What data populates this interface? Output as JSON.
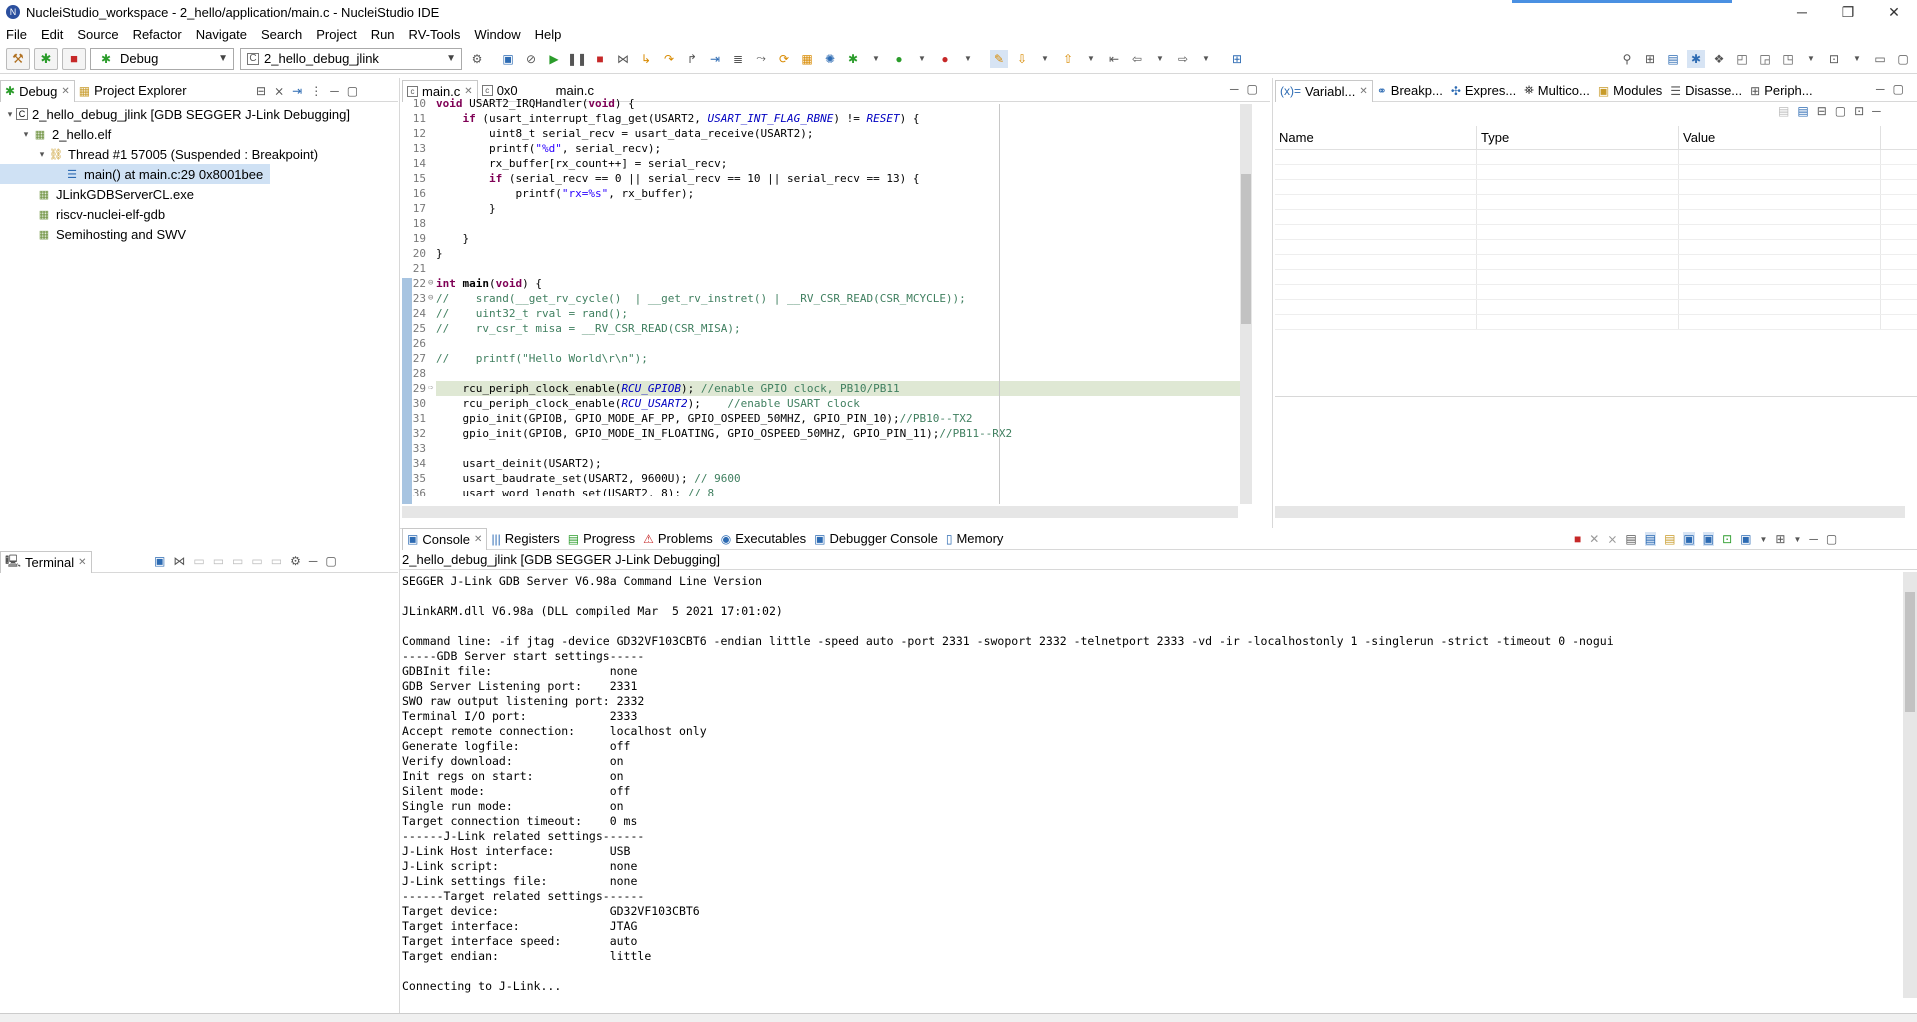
{
  "window": {
    "title": "NucleiStudio_workspace - 2_hello/application/main.c - NucleiStudio IDE"
  },
  "menu": [
    "File",
    "Edit",
    "Source",
    "Refactor",
    "Navigate",
    "Search",
    "Project",
    "Run",
    "RV-Tools",
    "Window",
    "Help"
  ],
  "toolbar": {
    "launch_mode": "Debug",
    "launch_config": "2_hello_debug_jlink"
  },
  "debug_view": {
    "tabs": [
      {
        "label": "Debug",
        "icon": "debug-bug-icon",
        "active": true
      },
      {
        "label": "Project Explorer",
        "icon": "folder-icon",
        "active": false
      }
    ],
    "tree": [
      {
        "label": "2_hello_debug_jlink [GDB SEGGER J-Link Debugging]",
        "level": 0,
        "icon": "c-launch-icon",
        "expanded": true
      },
      {
        "label": "2_hello.elf",
        "level": 1,
        "icon": "elf-icon",
        "expanded": true
      },
      {
        "label": "Thread #1 57005 (Suspended : Breakpoint)",
        "level": 2,
        "icon": "thread-icon",
        "expanded": true
      },
      {
        "label": "main() at main.c:29 0x8001bee",
        "level": 3,
        "icon": "stack-frame-icon",
        "selected": true
      },
      {
        "label": "JLinkGDBServerCL.exe",
        "level": 1,
        "icon": "process-icon"
      },
      {
        "label": "riscv-nuclei-elf-gdb",
        "level": 1,
        "icon": "process-icon"
      },
      {
        "label": "Semihosting and SWV",
        "level": 1,
        "icon": "process-icon"
      }
    ]
  },
  "terminal_view": {
    "tab": "Terminal"
  },
  "editor": {
    "tabs": [
      {
        "label": "main.c",
        "active": true
      },
      {
        "label": "0x0",
        "active": false
      },
      {
        "label": "main.c",
        "active": false
      }
    ],
    "first_line_partial": "void USART2_IRQHandler(void) {",
    "lines": [
      {
        "n": "10",
        "html": "<span class=\"kw\">void</span> USART2_IRQHandler(<span class=\"kw\">void</span>) {"
      },
      {
        "n": "11",
        "html": "    <span class=\"kw\">if</span> (usart_interrupt_flag_get(USART2, <span class=\"mac\">USART_INT_FLAG_RBNE</span>) != <span class=\"mac\">RESET</span>) {"
      },
      {
        "n": "12",
        "html": "        uint8_t serial_recv = usart_data_receive(USART2);"
      },
      {
        "n": "13",
        "html": "        printf(<span class=\"str\">\"%d\"</span>, serial_recv);"
      },
      {
        "n": "14",
        "html": "        rx_buffer[rx_count++] = serial_recv;"
      },
      {
        "n": "15",
        "html": "        <span class=\"kw\">if</span> (serial_recv == 0 || serial_recv == 10 || serial_recv == 13) {"
      },
      {
        "n": "16",
        "html": "            printf(<span class=\"str\">\"rx=%s\"</span>, rx_buffer);"
      },
      {
        "n": "17",
        "html": "        }"
      },
      {
        "n": "18",
        "html": ""
      },
      {
        "n": "19",
        "html": "    }"
      },
      {
        "n": "20",
        "html": "}"
      },
      {
        "n": "21",
        "html": ""
      },
      {
        "n": "22",
        "html": "<span class=\"kw\">int</span> <b>main</b>(<span class=\"kw\">void</span>) {",
        "fold": "⊖"
      },
      {
        "n": "23",
        "html": "<span class=\"cm\">//    srand(__get_rv_cycle()  | __get_rv_instret() | __RV_CSR_READ(CSR_MCYCLE));</span>",
        "fold": "⊖"
      },
      {
        "n": "24",
        "html": "<span class=\"cm\">//    uint32_t rval = rand();</span>"
      },
      {
        "n": "25",
        "html": "<span class=\"cm\">//    rv_csr_t misa = __RV_CSR_READ(CSR_MISA);</span>"
      },
      {
        "n": "26",
        "html": ""
      },
      {
        "n": "27",
        "html": "<span class=\"cm\">//    printf(\"Hello World\\r\\n\");</span>"
      },
      {
        "n": "28",
        "html": ""
      },
      {
        "n": "29",
        "html": "    rcu_periph_clock_enable(<span class=\"mac\">RCU_GPIOB</span>); <span class=\"cm\">//enable GPIO clock, PB10/PB11</span>",
        "hl": true,
        "fold": "⇨"
      },
      {
        "n": "30",
        "html": "    rcu_periph_clock_enable(<span class=\"mac\">RCU_USART2</span>);    <span class=\"cm\">//enable USART clock</span>"
      },
      {
        "n": "31",
        "html": "    gpio_init(GPIOB, GPIO_MODE_AF_PP, GPIO_OSPEED_50MHZ, GPIO_PIN_10);<span class=\"cm\">//PB10--TX2</span>"
      },
      {
        "n": "32",
        "html": "    gpio_init(GPIOB, GPIO_MODE_IN_FLOATING, GPIO_OSPEED_50MHZ, GPIO_PIN_11);<span class=\"cm\">//PB11--RX2</span>"
      },
      {
        "n": "33",
        "html": ""
      },
      {
        "n": "34",
        "html": "    usart_deinit(USART2);"
      },
      {
        "n": "35",
        "html": "    usart_baudrate_set(USART2, 9600U); <span class=\"cm\">// 9600</span>"
      },
      {
        "n": "36",
        "html": "    usart_word_length_set(USART2, 8); <span class=\"cm\">// 8</span>"
      }
    ]
  },
  "right_view": {
    "tabs": [
      {
        "label": "Variabl...",
        "icon": "variables-icon",
        "active": true
      },
      {
        "label": "Breakp...",
        "icon": "breakpoints-icon"
      },
      {
        "label": "Expres...",
        "icon": "expressions-icon"
      },
      {
        "label": "Multico...",
        "icon": "multicore-icon"
      },
      {
        "label": "Modules",
        "icon": "modules-icon"
      },
      {
        "label": "Disasse...",
        "icon": "disassembly-icon"
      },
      {
        "label": "Periph...",
        "icon": "peripherals-icon"
      }
    ],
    "columns": [
      "Name",
      "Type",
      "Value"
    ]
  },
  "console_view": {
    "tabs": [
      {
        "label": "Console",
        "icon": "console-icon",
        "active": true
      },
      {
        "label": "Registers",
        "icon": "registers-icon"
      },
      {
        "label": "Progress",
        "icon": "progress-icon"
      },
      {
        "label": "Problems",
        "icon": "problems-icon"
      },
      {
        "label": "Executables",
        "icon": "executables-icon"
      },
      {
        "label": "Debugger Console",
        "icon": "debugger-console-icon"
      },
      {
        "label": "Memory",
        "icon": "memory-icon"
      }
    ],
    "subtitle": "2_hello_debug_jlink [GDB SEGGER J-Link Debugging]",
    "lines": [
      "SEGGER J-Link GDB Server V6.98a Command Line Version",
      "",
      "JLinkARM.dll V6.98a (DLL compiled Mar  5 2021 17:01:02)",
      "",
      "Command line: -if jtag -device GD32VF103CBT6 -endian little -speed auto -port 2331 -swoport 2332 -telnetport 2333 -vd -ir -localhostonly 1 -singlerun -strict -timeout 0 -nogui",
      "-----GDB Server start settings-----",
      "GDBInit file:                 none",
      "GDB Server Listening port:    2331",
      "SWO raw output listening port: 2332",
      "Terminal I/O port:            2333",
      "Accept remote connection:     localhost only",
      "Generate logfile:             off",
      "Verify download:              on",
      "Init regs on start:           on",
      "Silent mode:                  off",
      "Single run mode:              on",
      "Target connection timeout:    0 ms",
      "------J-Link related settings------",
      "J-Link Host interface:        USB",
      "J-Link script:                none",
      "J-Link settings file:         none",
      "------Target related settings------",
      "Target device:                GD32VF103CBT6",
      "Target interface:             JTAG",
      "Target interface speed:       auto",
      "Target endian:                little",
      "",
      "Connecting to J-Link..."
    ]
  }
}
